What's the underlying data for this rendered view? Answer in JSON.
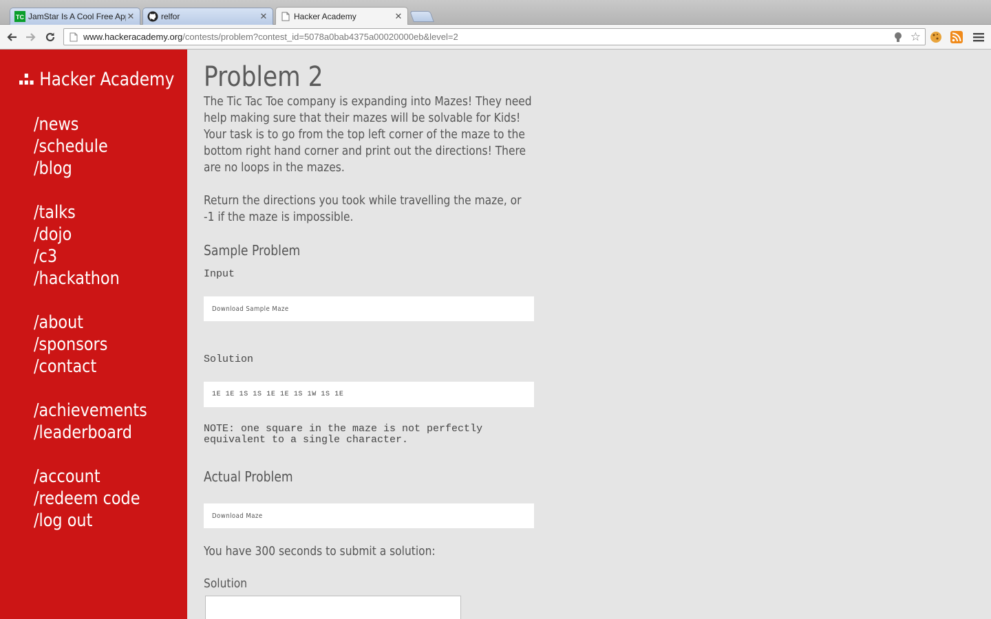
{
  "browser": {
    "tabs": [
      {
        "title": "JamStar Is A Cool Free App",
        "favicon": "techcrunch-icon"
      },
      {
        "title": "relfor",
        "favicon": "github-icon"
      },
      {
        "title": "Hacker Academy",
        "favicon": "page-icon"
      }
    ],
    "url_host": "www.hackeracademy.org",
    "url_path": "/contests/problem?contest_id=5078a0bab4375a00020000eb&level=2"
  },
  "sidebar": {
    "brand": "Hacker Academy",
    "groups": [
      [
        "/news",
        "/schedule",
        "/blog"
      ],
      [
        "/talks",
        "/dojo",
        "/c3",
        "/hackathon"
      ],
      [
        "/about",
        "/sponsors",
        "/contact"
      ],
      [
        "/achievements",
        "/leaderboard"
      ],
      [
        "/account",
        "/redeem code",
        "/log out"
      ]
    ]
  },
  "problem": {
    "title": "Problem 2",
    "description_lines": [
      "The Tic Tac Toe company is expanding into Mazes! They need",
      "help making sure that their mazes will be solvable for Kids!",
      "Your task is to go from the top left corner of the maze to the",
      "bottom right hand corner and print out the directions! There",
      "are no loops in the mazes."
    ],
    "return_lines": [
      "Return the directions you took while travelling the maze, or",
      "-1 if the maze is impossible."
    ],
    "sample_heading": "Sample Problem",
    "input_label": "Input",
    "sample_download": "Download Sample Maze",
    "solution_label": "Solution",
    "sample_solution": "1E 1E 1S 1S 1E 1E 1S 1W 1S 1E",
    "note_lines": [
      "NOTE: one square in the maze is not perfectly",
      "equivalent to a single character."
    ],
    "actual_heading": "Actual Problem",
    "actual_download": "Download Maze",
    "timer_text": "You have 300 seconds to submit a solution:",
    "submit_label": "Solution"
  },
  "colors": {
    "sidebar": "#cc1515",
    "page_bg": "#e5e5e5",
    "text": "#555555"
  }
}
